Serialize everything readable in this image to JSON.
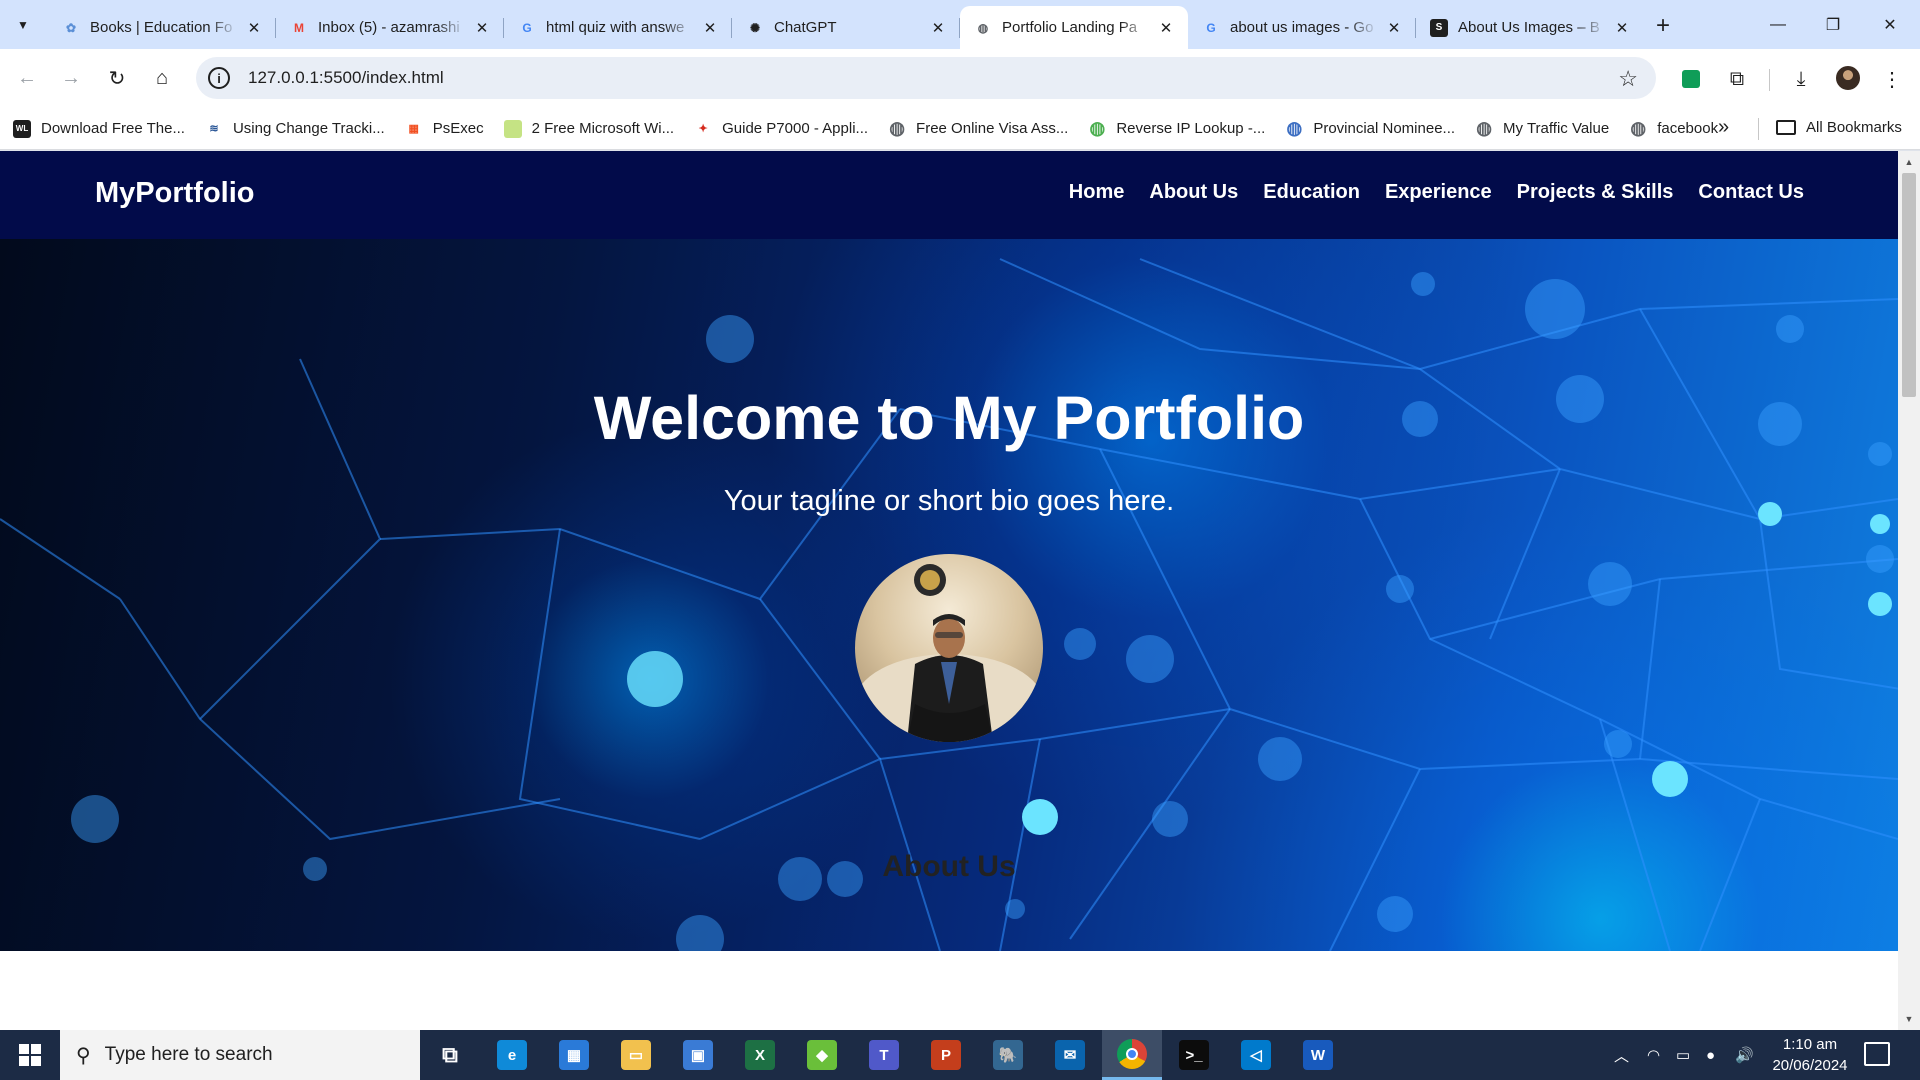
{
  "browser": {
    "tabs": [
      {
        "title": "Books | Education Fo",
        "favicon": "books-icon",
        "color": "#5b8fd6",
        "active": false
      },
      {
        "title": "Inbox (5) - azamrashi",
        "favicon": "gmail-icon",
        "color": "#ea4335",
        "active": false
      },
      {
        "title": "html quiz with answe",
        "favicon": "google-icon",
        "color": "#4285f4",
        "active": false
      },
      {
        "title": "ChatGPT",
        "favicon": "chatgpt-icon",
        "color": "#1f1f1f",
        "active": false
      },
      {
        "title": "Portfolio Landing Pa",
        "favicon": "globe-icon",
        "color": "#5f6368",
        "active": true
      },
      {
        "title": "about us images - Go",
        "favicon": "google-icon",
        "color": "#4285f4",
        "active": false
      },
      {
        "title": "About Us Images – B",
        "favicon": "shutterstock-icon",
        "color": "#1f1f1f",
        "active": false
      }
    ],
    "address_url": "127.0.0.1:5500/index.html",
    "bookmarks": [
      {
        "label": "Download Free The...",
        "icon": "bookmark-wl-icon",
        "color": "#1f1f1f"
      },
      {
        "label": "Using Change Tracki...",
        "icon": "bookmark-site-icon",
        "color": "#2b5797"
      },
      {
        "label": "PsExec",
        "icon": "microsoft-icon",
        "color": "#f25022"
      },
      {
        "label": "2 Free Microsoft Wi...",
        "icon": "bookmark-green-icon",
        "color": "#c5e384"
      },
      {
        "label": "Guide P7000 - Appli...",
        "icon": "canada-leaf-icon",
        "color": "#d52b1e"
      },
      {
        "label": "Free Online Visa Ass...",
        "icon": "globe-icon",
        "color": "#5f6368"
      },
      {
        "label": "Reverse IP Lookup -...",
        "icon": "globe-color-icon",
        "color": "#4caf50"
      },
      {
        "label": "Provincial Nominee...",
        "icon": "globe-seal-icon",
        "color": "#3c6ec2"
      },
      {
        "label": "My Traffic Value",
        "icon": "globe-icon",
        "color": "#5f6368"
      },
      {
        "label": "facebook",
        "icon": "globe-icon",
        "color": "#5f6368"
      }
    ],
    "all_bookmarks_label": "All Bookmarks"
  },
  "site": {
    "logo": "MyPortfolio",
    "nav_links": [
      "Home",
      "About Us",
      "Education",
      "Experience",
      "Projects & Skills",
      "Contact Us"
    ],
    "hero_title": "Welcome to My Portfolio",
    "hero_tagline": "Your tagline or short bio goes here.",
    "about_heading": "About Us",
    "colors": {
      "navbar": "#020b4a",
      "hero_dark": "#020a1c",
      "hero_light": "#0f7fe0"
    }
  },
  "taskbar": {
    "search_placeholder": "Type here to search",
    "apps": [
      {
        "name": "task-view-icon",
        "label": "⧉",
        "color": "#1c2b45",
        "active": false
      },
      {
        "name": "edge-icon",
        "label": "e",
        "color": "#0f8ad8",
        "active": false
      },
      {
        "name": "store-icon",
        "label": "▦",
        "color": "#2a7ad8",
        "active": false
      },
      {
        "name": "file-explorer-icon",
        "label": "▭",
        "color": "#f2c14e",
        "active": false
      },
      {
        "name": "remote-desktop-icon",
        "label": "▣",
        "color": "#3a7bd5",
        "active": false
      },
      {
        "name": "excel-icon",
        "label": "X",
        "color": "#1d7044",
        "active": false
      },
      {
        "name": "bluestacks-icon",
        "label": "◆",
        "color": "#6abf3a",
        "active": false
      },
      {
        "name": "teams-icon",
        "label": "T",
        "color": "#5059c9",
        "active": false
      },
      {
        "name": "powerpoint-icon",
        "label": "P",
        "color": "#c43e1c",
        "active": false
      },
      {
        "name": "postgres-icon",
        "label": "🐘",
        "color": "#336791",
        "active": false
      },
      {
        "name": "mail-icon",
        "label": "✉",
        "color": "#0a64ad",
        "active": false
      },
      {
        "name": "chrome-icon",
        "label": "◉",
        "color": "#db4437",
        "active": true
      },
      {
        "name": "terminal-icon",
        "label": ">_",
        "color": "#0c0c0c",
        "active": false
      },
      {
        "name": "vscode-icon",
        "label": "◁",
        "color": "#007acc",
        "active": false
      },
      {
        "name": "word-icon",
        "label": "W",
        "color": "#185abd",
        "active": false
      }
    ],
    "clock_time": "1:10 am",
    "clock_date": "20/06/2024"
  }
}
